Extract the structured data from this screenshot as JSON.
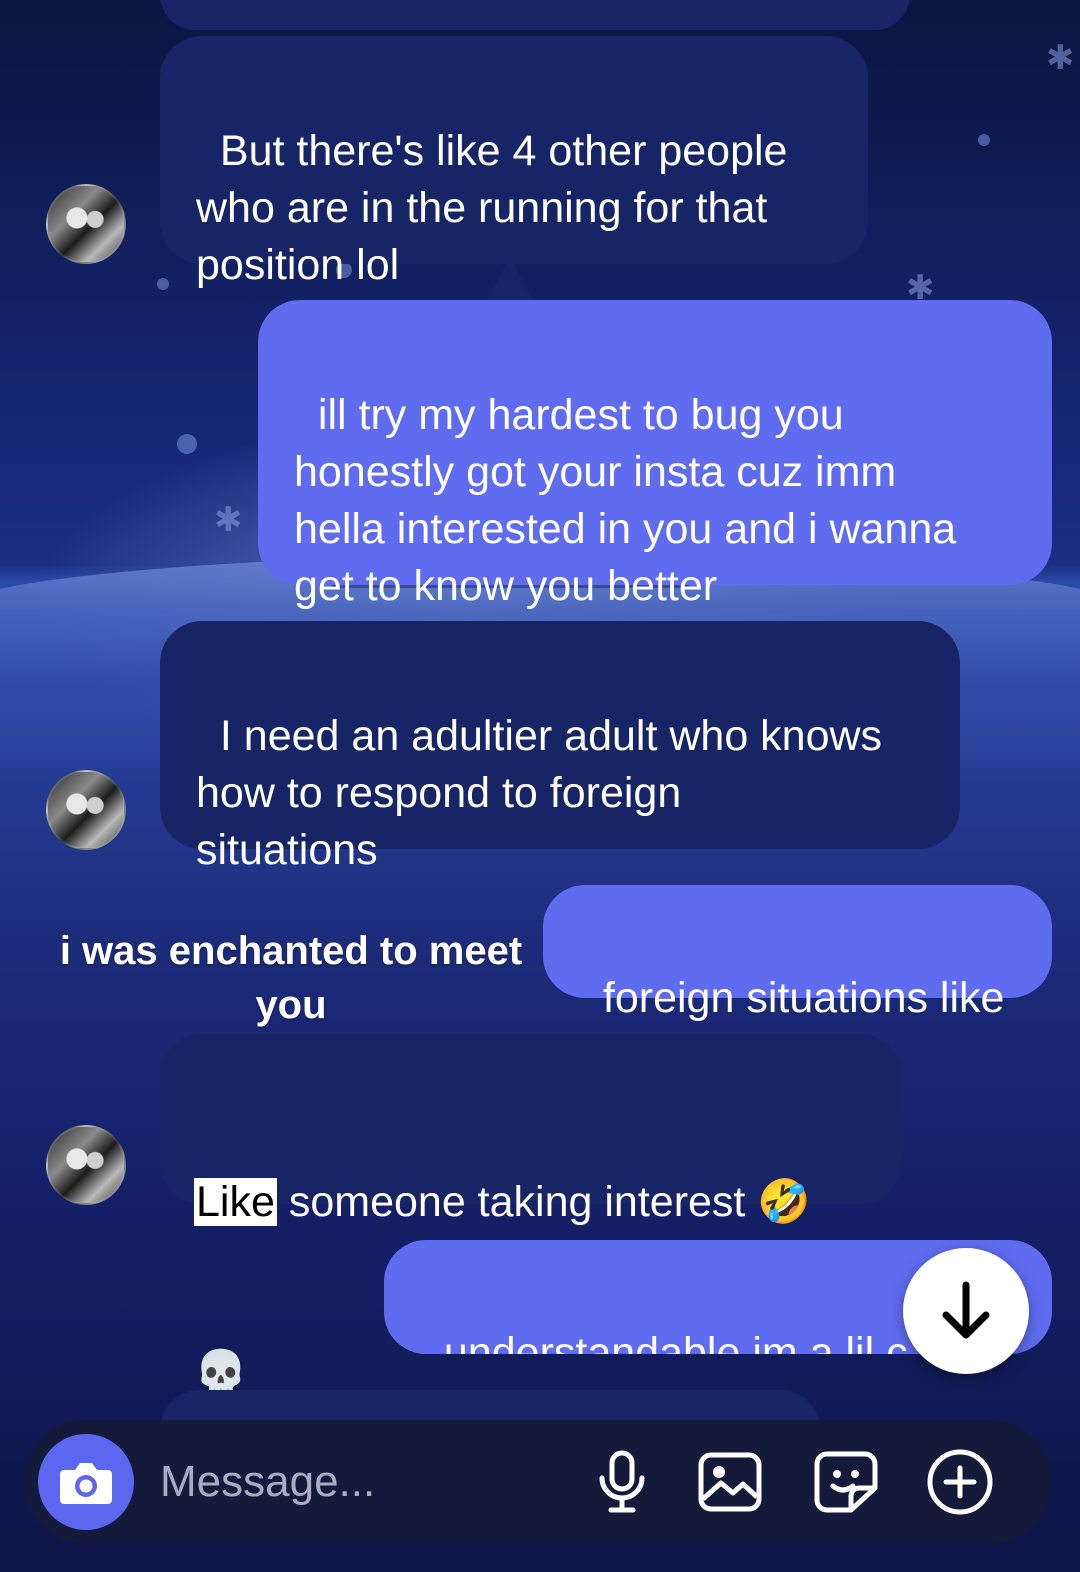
{
  "messages": [
    {
      "from": "them",
      "text": "But there's like 4 other people\nwho are in the running for that\nposition lol"
    },
    {
      "from": "me",
      "text": "ill try my hardest to bug you\nhonestly got your insta cuz imm\nhella interested in you and i wanna\nget to know you better"
    },
    {
      "from": "them",
      "text": "I need an adultier adult who knows\nhow to respond to foreign\nsituations"
    },
    {
      "from": "me",
      "text": "foreign situations like"
    },
    {
      "from": "them",
      "highlight": "Like",
      "text": " someone taking interest 🤣",
      "text2": "💀"
    },
    {
      "from": "me",
      "text": "understandable im a lil c"
    }
  ],
  "caption": {
    "line1": "i was enchanted to meet",
    "line2": "you"
  },
  "composer": {
    "placeholder": "Message...",
    "icons": [
      "camera-icon",
      "microphone-icon",
      "image-icon",
      "sticker-icon",
      "plus-icon"
    ]
  },
  "scroll_button": {
    "icon": "arrow-down-icon"
  },
  "colors": {
    "incoming": "#172566",
    "outgoing": "#5f6cf0",
    "camera": "#5b67ef"
  }
}
